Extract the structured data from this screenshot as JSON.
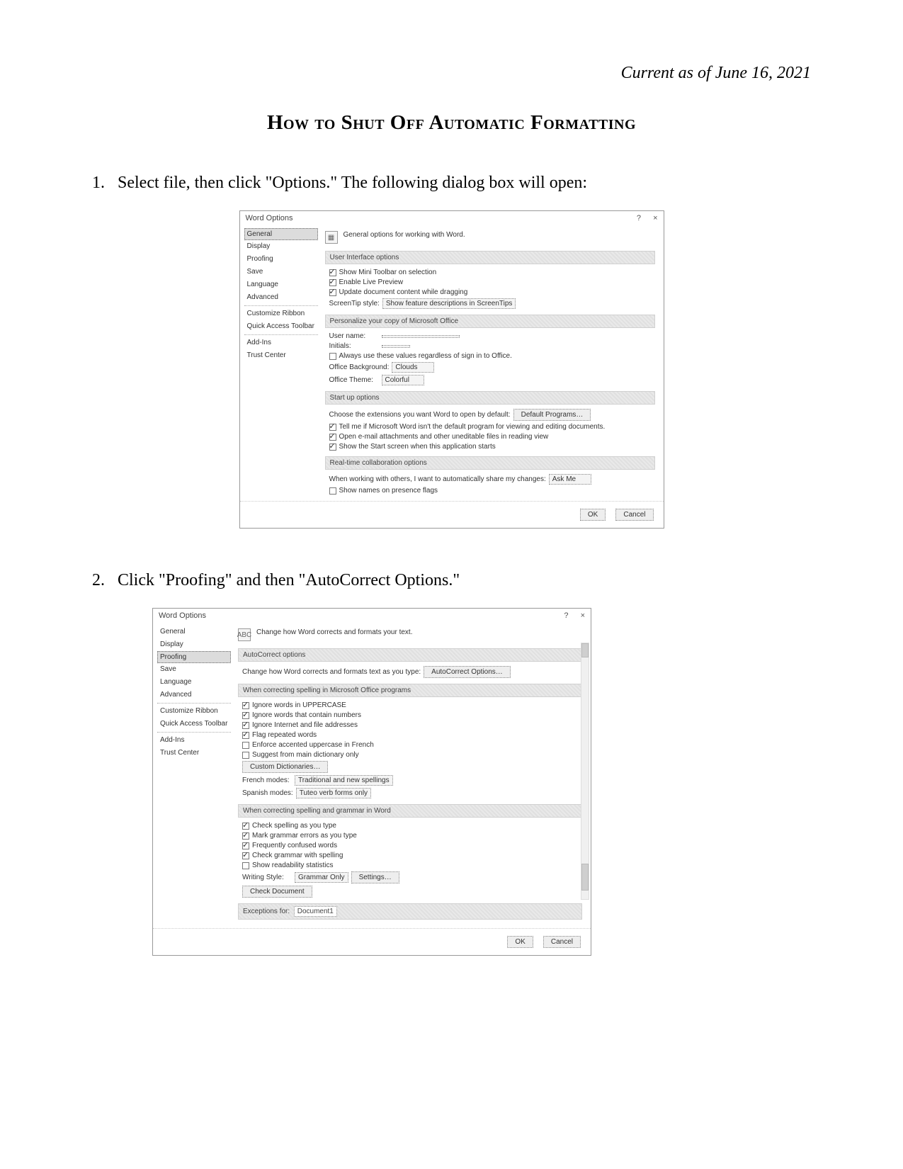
{
  "meta": {
    "date": "Current as of June 16, 2021"
  },
  "title": "How to Shut Off Automatic Formatting",
  "steps": {
    "s1": "Select file, then click \"Options.\"  The following dialog box will open:",
    "s2": "Click \"Proofing\" and then \"AutoCorrect Options.\""
  },
  "dialog1": {
    "title": "Word Options",
    "help": "?",
    "close": "×",
    "sidebar": [
      "General",
      "Display",
      "Proofing",
      "Save",
      "Language",
      "Advanced",
      "Customize Ribbon",
      "Quick Access Toolbar",
      "Add-Ins",
      "Trust Center"
    ],
    "desc": "General options for working with Word.",
    "sections": {
      "ui": {
        "header": "User Interface options",
        "opt1": "Show Mini Toolbar on selection",
        "opt2": "Enable Live Preview",
        "opt3": "Update document content while dragging",
        "screentip_label": "ScreenTip style:",
        "screentip_value": "Show feature descriptions in ScreenTips"
      },
      "personalize": {
        "header": "Personalize your copy of Microsoft Office",
        "username_label": "User name:",
        "username_value": "",
        "initials_label": "Initials:",
        "initials_value": "",
        "always": "Always use these values regardless of sign in to Office.",
        "bg_label": "Office Background:",
        "bg_value": "Clouds",
        "theme_label": "Office Theme:",
        "theme_value": "Colorful"
      },
      "startup": {
        "header": "Start up options",
        "choose": "Choose the extensions you want Word to open by default:",
        "default_btn": "Default Programs…",
        "opt1": "Tell me if Microsoft Word isn't the default program for viewing and editing documents.",
        "opt2": "Open e-mail attachments and other uneditable files in reading view",
        "opt3": "Show the Start screen when this application starts"
      },
      "collab": {
        "header": "Real-time collaboration options",
        "when": "When working with others, I want to automatically share my changes:",
        "when_value": "Ask Me",
        "show_names": "Show names on presence flags"
      }
    },
    "ok": "OK",
    "cancel": "Cancel"
  },
  "dialog2": {
    "title": "Word Options",
    "help": "?",
    "close": "×",
    "sidebar": [
      "General",
      "Display",
      "Proofing",
      "Save",
      "Language",
      "Advanced",
      "Customize Ribbon",
      "Quick Access Toolbar",
      "Add-Ins",
      "Trust Center"
    ],
    "desc": "Change how Word corrects and formats your text.",
    "sections": {
      "ac": {
        "header": "AutoCorrect options",
        "line": "Change how Word corrects and formats text as you type:",
        "button": "AutoCorrect Options…"
      },
      "msspell": {
        "header": "When correcting spelling in Microsoft Office programs",
        "opt1": "Ignore words in UPPERCASE",
        "opt2": "Ignore words that contain numbers",
        "opt3": "Ignore Internet and file addresses",
        "opt4": "Flag repeated words",
        "opt5": "Enforce accented uppercase in French",
        "opt6": "Suggest from main dictionary only",
        "cust_btn": "Custom Dictionaries…",
        "french_label": "French modes:",
        "french_value": "Traditional and new spellings",
        "spanish_label": "Spanish modes:",
        "spanish_value": "Tuteo verb forms only"
      },
      "wordspell": {
        "header": "When correcting spelling and grammar in Word",
        "opt1": "Check spelling as you type",
        "opt2": "Mark grammar errors as you type",
        "opt3": "Frequently confused words",
        "opt4": "Check grammar with spelling",
        "opt5": "Show readability statistics",
        "style_label": "Writing Style:",
        "style_value": "Grammar Only",
        "settings_btn": "Settings…",
        "check_btn": "Check Document"
      },
      "exceptions": {
        "header": "Exceptions for:",
        "value": "Document1"
      }
    },
    "ok": "OK",
    "cancel": "Cancel"
  }
}
